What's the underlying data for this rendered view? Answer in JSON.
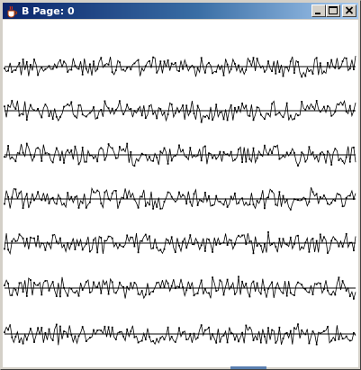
{
  "window": {
    "title": "B Page: 0"
  },
  "icons": {
    "app": "java-coffee-cup-icon",
    "minimize": "minimize-icon",
    "maximize": "maximize-icon",
    "close": "close-icon"
  },
  "plot": {
    "trace_count": 7,
    "samples_per_trace": 190,
    "trace_color": "#000000",
    "baseline_color": "#000000",
    "background": "#ffffff"
  }
}
